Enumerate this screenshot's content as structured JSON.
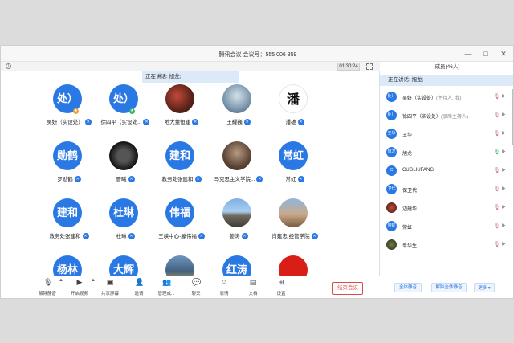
{
  "window": {
    "title": "腾讯会议 会议号：555 006 359"
  },
  "meeting": {
    "timer": "01:30:24",
    "speaking": "正在讲话: 旭龙;",
    "end_label": "结束会议"
  },
  "participants": [
    {
      "avatar_text": "处）",
      "label": "吴妍（实设处）",
      "style": "blue",
      "badge": "orange"
    },
    {
      "avatar_text": "处）",
      "label": "徐四平（实设处...",
      "style": "blue",
      "badge": "green"
    },
    {
      "avatar_text": "",
      "label": "地大董恒建",
      "style": "photo",
      "photo": "p1"
    },
    {
      "avatar_text": "",
      "label": "王耀巍",
      "style": "photo",
      "photo": "p2"
    },
    {
      "avatar_text": "潘",
      "label": "潘雄",
      "style": "photo-text",
      "photo": "p3"
    },
    {
      "avatar_text": "勋鹤",
      "label": "罗勋鹤",
      "style": "blue"
    },
    {
      "avatar_text": "",
      "label": "晋曦",
      "style": "photo",
      "photo": "p4"
    },
    {
      "avatar_text": "建和",
      "label": "教务处张建和",
      "style": "blue"
    },
    {
      "avatar_text": "",
      "label": "马克思主义学院...",
      "style": "photo",
      "photo": "p5"
    },
    {
      "avatar_text": "常虹",
      "label": "常虹",
      "style": "blue"
    },
    {
      "avatar_text": "建和",
      "label": "教务处张建和",
      "style": "blue"
    },
    {
      "avatar_text": "杜琳",
      "label": "杜琳",
      "style": "blue"
    },
    {
      "avatar_text": "伟福",
      "label": "三峡中心-滕伟福",
      "style": "blue"
    },
    {
      "avatar_text": "",
      "label": "姜涛",
      "style": "photo",
      "photo": "p6"
    },
    {
      "avatar_text": "",
      "label": "肖建忠 经管学院",
      "style": "photo",
      "photo": "p7"
    },
    {
      "avatar_text": "杨林",
      "label": "",
      "style": "blue"
    },
    {
      "avatar_text": "大辉",
      "label": "",
      "style": "blue"
    },
    {
      "avatar_text": "",
      "label": "",
      "style": "photo",
      "photo": "p8"
    },
    {
      "avatar_text": "红涛",
      "label": "",
      "style": "blue"
    },
    {
      "avatar_text": "",
      "label": "",
      "style": "photo",
      "photo": "p9"
    }
  ],
  "toolbar": {
    "mute": "解除静音",
    "video": "开启视频",
    "share": "共享屏幕",
    "invite": "邀请",
    "manage": "管理成...",
    "chat": "聊天",
    "reactions": "表情",
    "docs": "文档",
    "settings": "设置"
  },
  "sidebar": {
    "title": "成员(46人)",
    "speaking": "正在讲话: 旭龙;",
    "members": [
      {
        "avatar": "处）",
        "name": "吴妍（实设处）",
        "role": "(主持人, 我)",
        "mic": "muted"
      },
      {
        "avatar": "处）",
        "name": "徐四平（实设处）",
        "role": "(联席主持人)",
        "mic": "muted"
      },
      {
        "avatar": "王华",
        "name": "王华",
        "role": "",
        "mic": "muted"
      },
      {
        "avatar": "旭龙",
        "name": "旭龙",
        "role": "",
        "mic": "active"
      },
      {
        "avatar": "C",
        "name": "CUGLIUFANG",
        "role": "",
        "mic": "muted"
      },
      {
        "avatar": "卫代",
        "name": "保卫代",
        "role": "",
        "mic": "muted"
      },
      {
        "avatar": "",
        "name": "边建华",
        "role": "",
        "mic": "muted",
        "photo": "photo-a"
      },
      {
        "avatar": "常虹",
        "name": "常虹",
        "role": "",
        "mic": "muted"
      },
      {
        "avatar": "",
        "name": "单华生",
        "role": "",
        "mic": "muted",
        "photo": "photo-b"
      }
    ],
    "mute_all": "全体静音",
    "unmute_all": "解除全体静音",
    "more": "更多"
  }
}
